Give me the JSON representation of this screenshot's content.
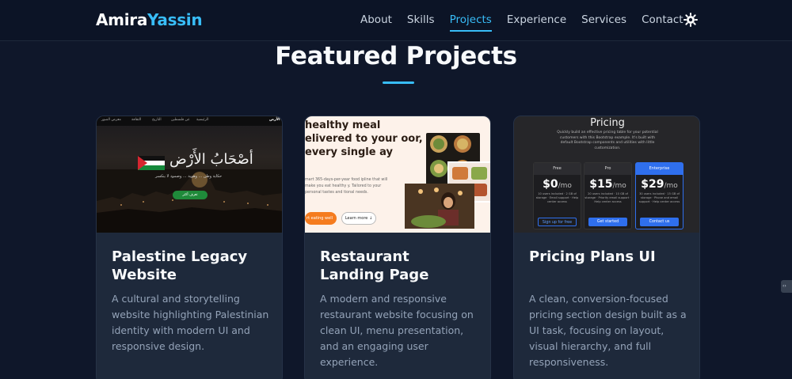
{
  "brand": {
    "first": "Amira",
    "last": "Yassin",
    "accent": "#38bdf8"
  },
  "nav": {
    "items": [
      {
        "label": "About",
        "active": false
      },
      {
        "label": "Skills",
        "active": false
      },
      {
        "label": "Projects",
        "active": true
      },
      {
        "label": "Experience",
        "active": false
      },
      {
        "label": "Services",
        "active": false
      },
      {
        "label": "Contact",
        "active": false
      }
    ],
    "theme_icon": "sun-gear-icon"
  },
  "section": {
    "title": "Featured Projects"
  },
  "projects": [
    {
      "title": "Palestine Legacy Website",
      "description": "A cultural and storytelling website highlighting Palestinian identity with modern UI and responsive design.",
      "thumb": {
        "arabic_title": "أصْحَابُ الأَرْض",
        "arabic_sub": "حكاية وطن ... وهوية ... وصمود لا ينكسر",
        "button": "تعرف أكثر",
        "logo": "الأرض",
        "menu": [
          "الرئيسية",
          "عن فلسطين",
          "التاريخ",
          "الثقافة",
          "معرض الصور"
        ]
      }
    },
    {
      "title": "Restaurant Landing Page",
      "description": "A modern and responsive restaurant website focusing on clean UI, menu presentation, and an engaging user experience.",
      "thumb": {
        "headline": "healthy meal elivered to your oor, every single ay",
        "text": "mart 365-days-per-year food ipline that will make you eat healthy y. Tailored to your personal tastes and tional needs.",
        "primary": "rt eating well",
        "secondary": "Learn more ↓"
      }
    },
    {
      "title": "Pricing Plans UI",
      "description": "A clean, conversion-focused pricing section design built as a UI task, focusing on layout, visual hierarchy, and full responsiveness.",
      "thumb": {
        "title": "Pricing",
        "text": "Quickly build an effective pricing table for your potential customers with this Bootstrap example. It's built with default Bootstrap components and utilities with little customization.",
        "plans": [
          {
            "name": "Free",
            "price": "$0",
            "per": "/mo",
            "lines": "10 users included · 2 GB of storage · Email support · Help center access",
            "button": "Sign up for free",
            "highlight": false
          },
          {
            "name": "Pro",
            "price": "$15",
            "per": "/mo",
            "lines": "20 users included · 10 GB of storage · Priority email support · Help center access",
            "button": "Get started",
            "highlight": false
          },
          {
            "name": "Enterprise",
            "price": "$29",
            "per": "/mo",
            "lines": "30 users included · 15 GB of storage · Phone and email support · Help center access",
            "button": "Contact us",
            "highlight": true
          }
        ]
      }
    }
  ]
}
